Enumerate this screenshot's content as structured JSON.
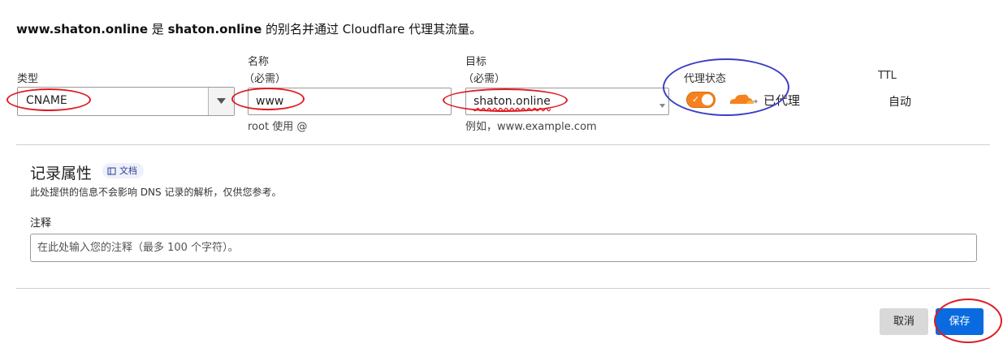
{
  "summary": {
    "alias_name": "www.shaton.online",
    "connector": " 是 ",
    "target_name": "shaton.online",
    "suffix": " 的别名并通过 Cloudflare 代理其流量。"
  },
  "form": {
    "type": {
      "label": "类型",
      "value": "CNAME"
    },
    "name": {
      "label": "名称",
      "required": "（必需）",
      "value": "www",
      "hint": "root 使用 @"
    },
    "target": {
      "label": "目标",
      "required": "（必需）",
      "value": "shaton.online",
      "hint": "例如，www.example.com"
    },
    "proxy": {
      "label": "代理状态",
      "enabled": true,
      "status_text": "已代理",
      "icon": "cloud-icon",
      "toggle_check": "✓"
    },
    "ttl": {
      "label": "TTL",
      "value": "自动"
    }
  },
  "record_attributes": {
    "title": "记录属性",
    "doc_badge": "文档",
    "doc_icon": "book-icon",
    "description": "此处提供的信息不会影响 DNS 记录的解析，仅供您参考。",
    "note_label": "注释",
    "note_placeholder": "在此处输入您的注释（最多 100 个字符）。",
    "note_value": ""
  },
  "actions": {
    "cancel_label": "取消",
    "save_label": "保存"
  },
  "colors": {
    "accent_orange": "#f6821f",
    "primary_blue": "#0a6be0",
    "annotation_red": "#e01b22",
    "annotation_blue": "#3b3fc2"
  }
}
